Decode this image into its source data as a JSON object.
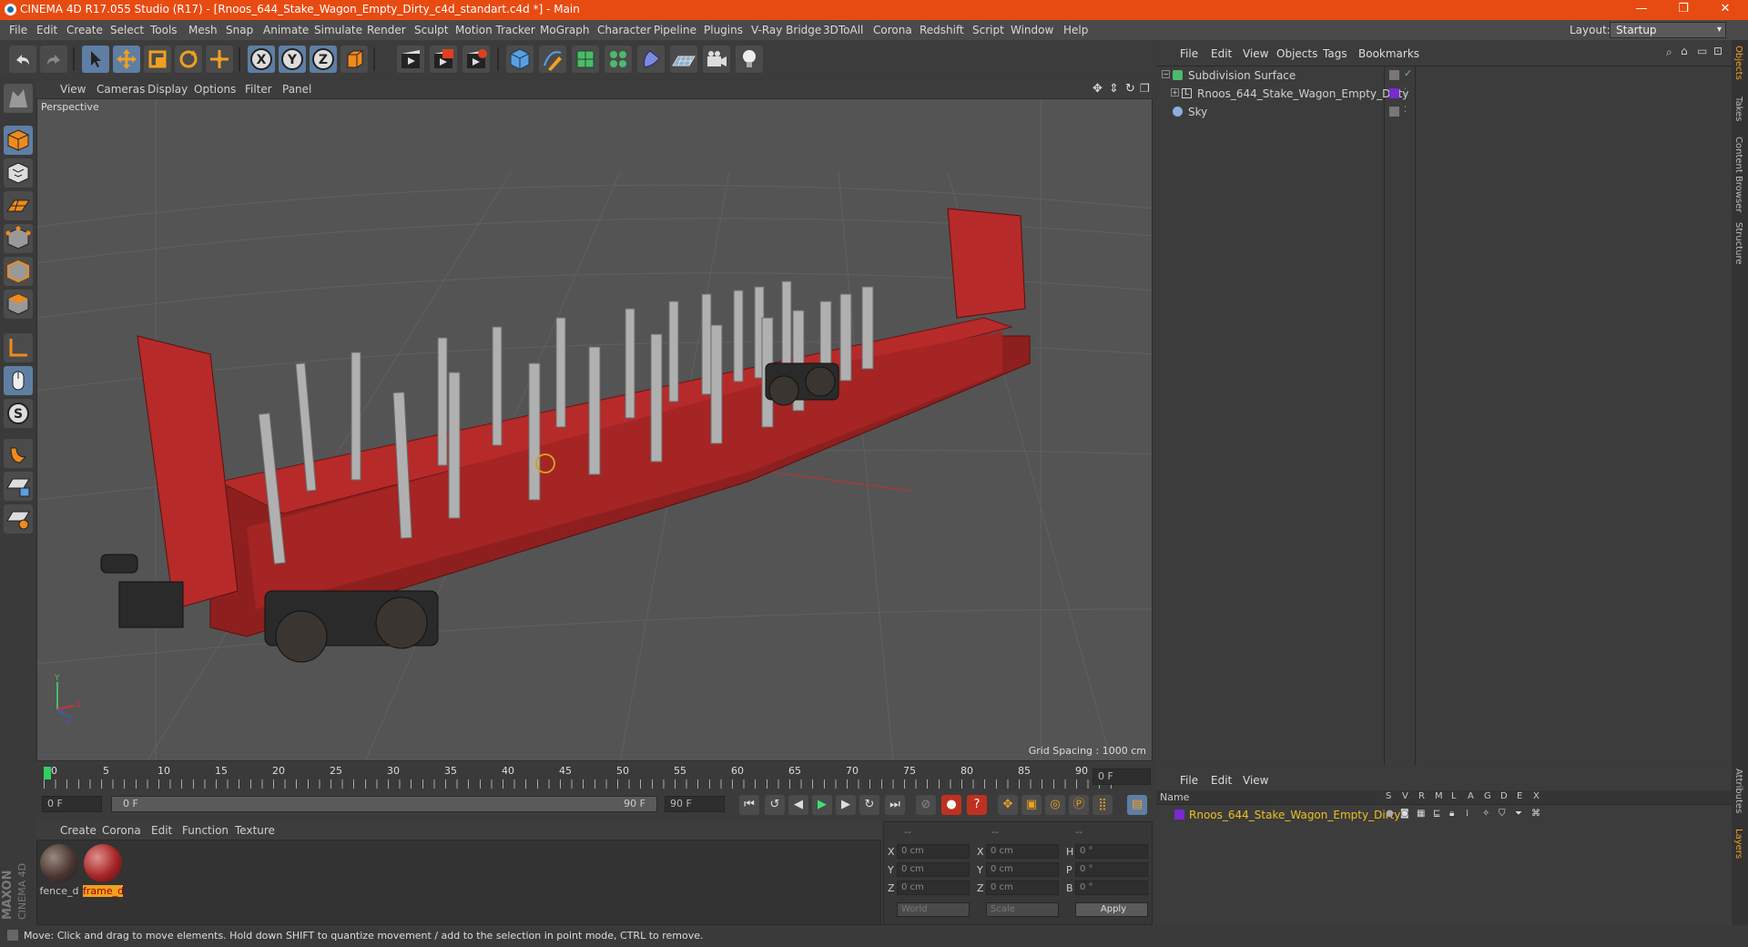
{
  "window": {
    "title": "CINEMA 4D R17.055 Studio (R17) - [Rnoos_644_Stake_Wagon_Empty_Dirty_c4d_standart.c4d *] - Main",
    "controls": [
      "—",
      "❐",
      "✕"
    ]
  },
  "menubar": {
    "items": [
      "File",
      "Edit",
      "Create",
      "Select",
      "Tools",
      "Mesh",
      "Snap",
      "Animate",
      "Simulate",
      "Render",
      "Sculpt",
      "Motion Tracker",
      "MoGraph",
      "Character",
      "Pipeline",
      "Plugins",
      "V-Ray Bridge",
      "3DToAll",
      "Corona",
      "Redshift",
      "Script",
      "Window",
      "Help"
    ],
    "layout_label": "Layout:",
    "layout_value": "Startup"
  },
  "toolbar": {
    "icons": [
      "undo-icon",
      "redo-icon",
      "select-arrow-icon",
      "move-icon",
      "scale-icon",
      "rotate-icon",
      "move-alt-icon",
      "x-axis-icon",
      "y-axis-icon",
      "z-axis-icon",
      "world-coord-icon",
      "render-view-icon",
      "render-picture-queue-icon",
      "render-settings-icon",
      "cube-icon",
      "pen-icon",
      "subdivision-icon",
      "cloner-icon",
      "deformer-icon",
      "floor-icon",
      "camera-icon",
      "light-icon"
    ],
    "axis_labels": [
      "X",
      "Y",
      "Z"
    ]
  },
  "viewport": {
    "menu": [
      "View",
      "Cameras",
      "Display",
      "Options",
      "Filter",
      "Panel"
    ],
    "label": "Perspective",
    "grid_spacing": "Grid Spacing : 1000 cm"
  },
  "timeline": {
    "ticks": [
      "0",
      "5",
      "10",
      "15",
      "20",
      "25",
      "30",
      "35",
      "40",
      "45",
      "50",
      "55",
      "60",
      "65",
      "70",
      "75",
      "80",
      "85",
      "90"
    ],
    "current_frame": "0 F",
    "start_field": "0 F",
    "range_start": "0 F",
    "range_end": "90 F",
    "end_field": "90 F"
  },
  "materials": {
    "menu": [
      "Create",
      "Corona",
      "Edit",
      "Function",
      "Texture"
    ],
    "items": [
      {
        "name": "fence_d",
        "selected": false
      },
      {
        "name": "frame_d",
        "selected": true
      }
    ]
  },
  "coordinates": {
    "headers": [
      "--",
      "--",
      "--"
    ],
    "rows": [
      {
        "a": "X",
        "av": "0 cm",
        "b": "X",
        "bv": "0 cm",
        "c": "H",
        "cv": "0 °"
      },
      {
        "a": "Y",
        "av": "0 cm",
        "b": "Y",
        "bv": "0 cm",
        "c": "P",
        "cv": "0 °"
      },
      {
        "a": "Z",
        "av": "0 cm",
        "b": "Z",
        "bv": "0 cm",
        "c": "B",
        "cv": "0 °"
      }
    ],
    "mode_world": "World",
    "mode_scale": "Scale",
    "apply": "Apply"
  },
  "objects_panel": {
    "menu": [
      "File",
      "Edit",
      "View",
      "Objects",
      "Tags",
      "Bookmarks"
    ],
    "items": [
      {
        "name": "Subdivision Surface",
        "indent": 0
      },
      {
        "name": "Rnoos_644_Stake_Wagon_Empty_Dirty",
        "indent": 1
      },
      {
        "name": "Sky",
        "indent": 0
      }
    ]
  },
  "layers_panel": {
    "menu": [
      "File",
      "Edit",
      "View"
    ],
    "name_header": "Name",
    "flag_headers": [
      "S",
      "V",
      "R",
      "M",
      "L",
      "A",
      "G",
      "D",
      "E",
      "X"
    ],
    "row_name": "Rnoos_644_Stake_Wagon_Empty_Dirty"
  },
  "right_tabs": [
    "Objects",
    "Takes",
    "Content Browser",
    "Structure",
    "Attributes",
    "Layers"
  ],
  "status": "Move: Click and drag to move elements. Hold down SHIFT to quantize movement / add to the selection in point mode, CTRL to remove.",
  "brand": "MAXON CINEMA 4D",
  "colors": {
    "titlebar": "#e84b12",
    "accent_orange": "#f08a1c",
    "wagon_red": "#b72a2a",
    "selection_yellow": "#f0c020"
  }
}
